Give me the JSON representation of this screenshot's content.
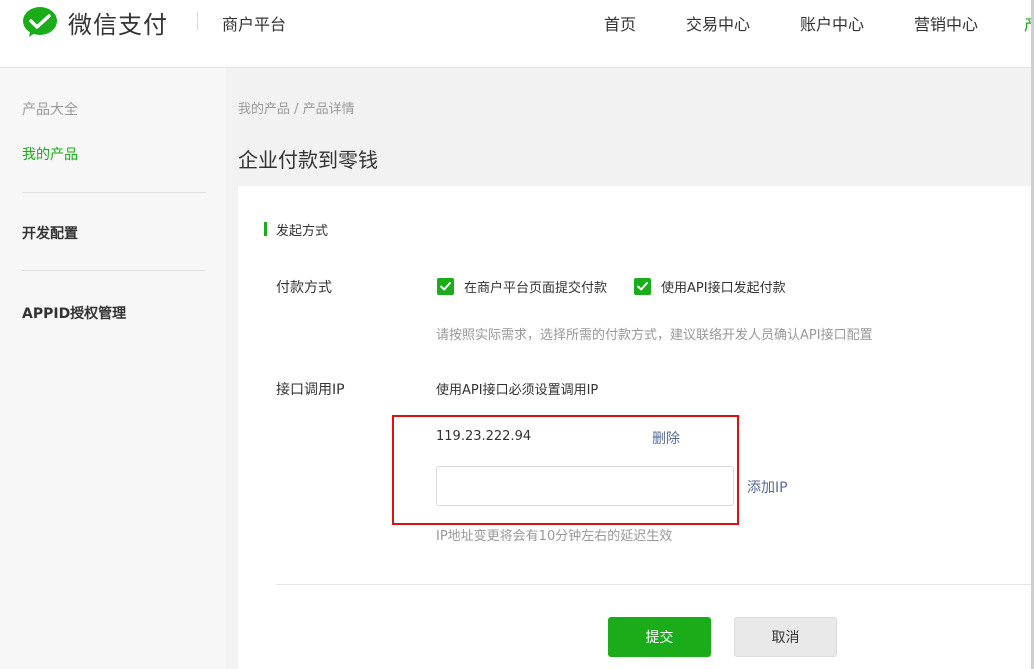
{
  "header": {
    "logo_text": "微信支付",
    "platform": "商户平台",
    "nav": [
      "首页",
      "交易中心",
      "账户中心",
      "营销中心",
      "产"
    ]
  },
  "sidebar": {
    "group_title": "产品大全",
    "my_products": "我的产品",
    "dev_config": "开发配置",
    "appid_auth": "APPID授权管理"
  },
  "main": {
    "breadcrumb": "我的产品 / 产品详情",
    "title": "企业付款到零钱",
    "section_title": "发起方式",
    "payment_method_label": "付款方式",
    "checkbox1_label": "在商户平台页面提交付款",
    "checkbox2_label": "使用API接口发起付款",
    "payment_hint": "请按照实际需求，选择所需的付款方式，建议联络开发人员确认API接口配置",
    "ip_label": "接口调用IP",
    "ip_desc": "使用API接口必须设置调用IP",
    "ip_value": "119.23.222.94",
    "delete_link": "删除",
    "ip_input_value": "",
    "add_ip_link": "添加IP",
    "ip_hint": "IP地址变更将会有10分钟左右的延迟生效",
    "submit_button": "提交",
    "cancel_button": "取消"
  },
  "colors": {
    "brand_green": "#1aad19",
    "link_blue": "#576b95",
    "highlight_red": "#e01010"
  }
}
